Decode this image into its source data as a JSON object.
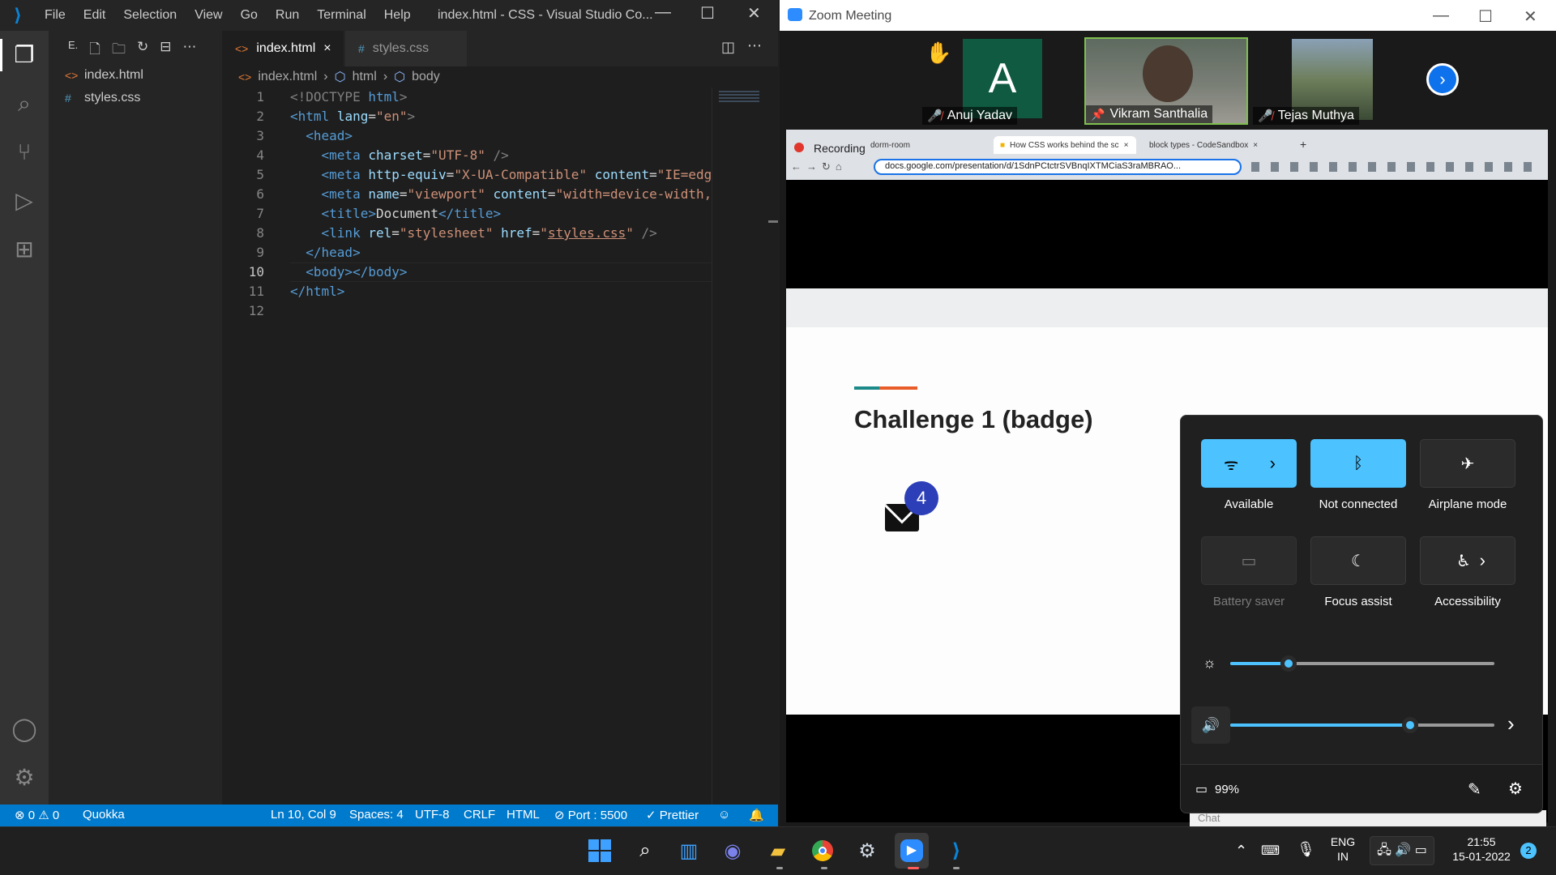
{
  "vscode": {
    "menu": [
      "File",
      "Edit",
      "Selection",
      "View",
      "Go",
      "Run",
      "Terminal",
      "Help"
    ],
    "window_title": "index.html - CSS - Visual Studio Co...",
    "explorer_label": "E.",
    "files": [
      {
        "name": "index.html",
        "icon": "<>"
      },
      {
        "name": "styles.css",
        "icon": "#"
      }
    ],
    "tabs": [
      {
        "label": "index.html",
        "icon": "<>",
        "close": "×"
      },
      {
        "label": "styles.css",
        "icon": "#"
      }
    ],
    "breadcrumb": [
      "index.html",
      "html",
      "body"
    ],
    "line_numbers": [
      "1",
      "2",
      "3",
      "4",
      "5",
      "6",
      "7",
      "8",
      "9",
      "10",
      "11",
      "12"
    ],
    "current_line": "10",
    "code": {
      "l1_doctype": "<!DOCTYPE",
      "l1_html": "html",
      "l2_tag": "<html",
      "l2_attr": "lang",
      "l2_val": "\"en\"",
      "l3": "<head>",
      "l4_tag": "<meta",
      "l4_attr": "charset",
      "l4_val": "\"UTF-8\"",
      "l5_tag": "<meta",
      "l5_attr1": "http-equiv",
      "l5_val1": "\"X-UA-Compatible\"",
      "l5_attr2": "content",
      "l5_val2": "\"IE=edg",
      "l6_tag": "<meta",
      "l6_attr1": "name",
      "l6_val1": "\"viewport\"",
      "l6_attr2": "content",
      "l6_val2": "\"width=device-width,",
      "l7_open": "<title>",
      "l7_text": "Document",
      "l7_close": "</title>",
      "l8_tag": "<link",
      "l8_attr1": "rel",
      "l8_val1": "\"stylesheet\"",
      "l8_attr2": "href",
      "l8_val2": "styles.css",
      "l9": "</head>",
      "l10": "<body></body>",
      "l11": "</html>"
    },
    "status": {
      "problems": "⊗ 0 ⚠ 0",
      "quokka": "Quokka",
      "position": "Ln 10, Col 9",
      "spaces": "Spaces: 4",
      "encoding": "UTF-8",
      "eol": "CRLF",
      "language": "HTML",
      "port": "⊘ Port : 5500",
      "prettier": "✓ Prettier"
    }
  },
  "zoom": {
    "title": "Zoom Meeting",
    "participants": [
      {
        "name": "Anuj Yadav",
        "initial": "A",
        "raised_hand": "✋"
      },
      {
        "name": "Vikram Santhalia"
      },
      {
        "name": "Tejas Muthya"
      }
    ],
    "chrome": {
      "recording_label": "Recording",
      "tabs": [
        "dorm-room",
        "How CSS works behind the sc",
        "block types - CodeSandbox"
      ],
      "url": "docs.google.com/presentation/d/1SdnPCtctrSVBnqIXTMCiaS3raMBRAO..."
    },
    "slide": {
      "title": "Challenge 1 (badge)",
      "badge_count": "4"
    },
    "chat_label": "Chat"
  },
  "quick_settings": {
    "tiles": [
      {
        "label": "Available",
        "state": "on",
        "icon": "wifi-icon"
      },
      {
        "label": "Not connected",
        "state": "on",
        "icon": "bluetooth-icon"
      },
      {
        "label": "Airplane mode",
        "state": "off",
        "icon": "airplane-icon"
      },
      {
        "label": "Battery saver",
        "state": "disabled",
        "icon": "battery-saver-icon"
      },
      {
        "label": "Focus assist",
        "state": "off",
        "icon": "moon-icon"
      },
      {
        "label": "Accessibility",
        "state": "off",
        "icon": "accessibility-icon"
      }
    ],
    "brightness": 0.22,
    "volume": 0.68,
    "battery": "99%"
  },
  "taskbar": {
    "language_top": "ENG",
    "language_bottom": "IN",
    "time": "21:55",
    "date": "15-01-2022",
    "notifications": "2"
  },
  "colors": {
    "vscode_status": "#007acc",
    "qs_accent": "#4cc2ff",
    "zoom_blue": "#2d8cff",
    "badge": "#2c3fb8"
  }
}
